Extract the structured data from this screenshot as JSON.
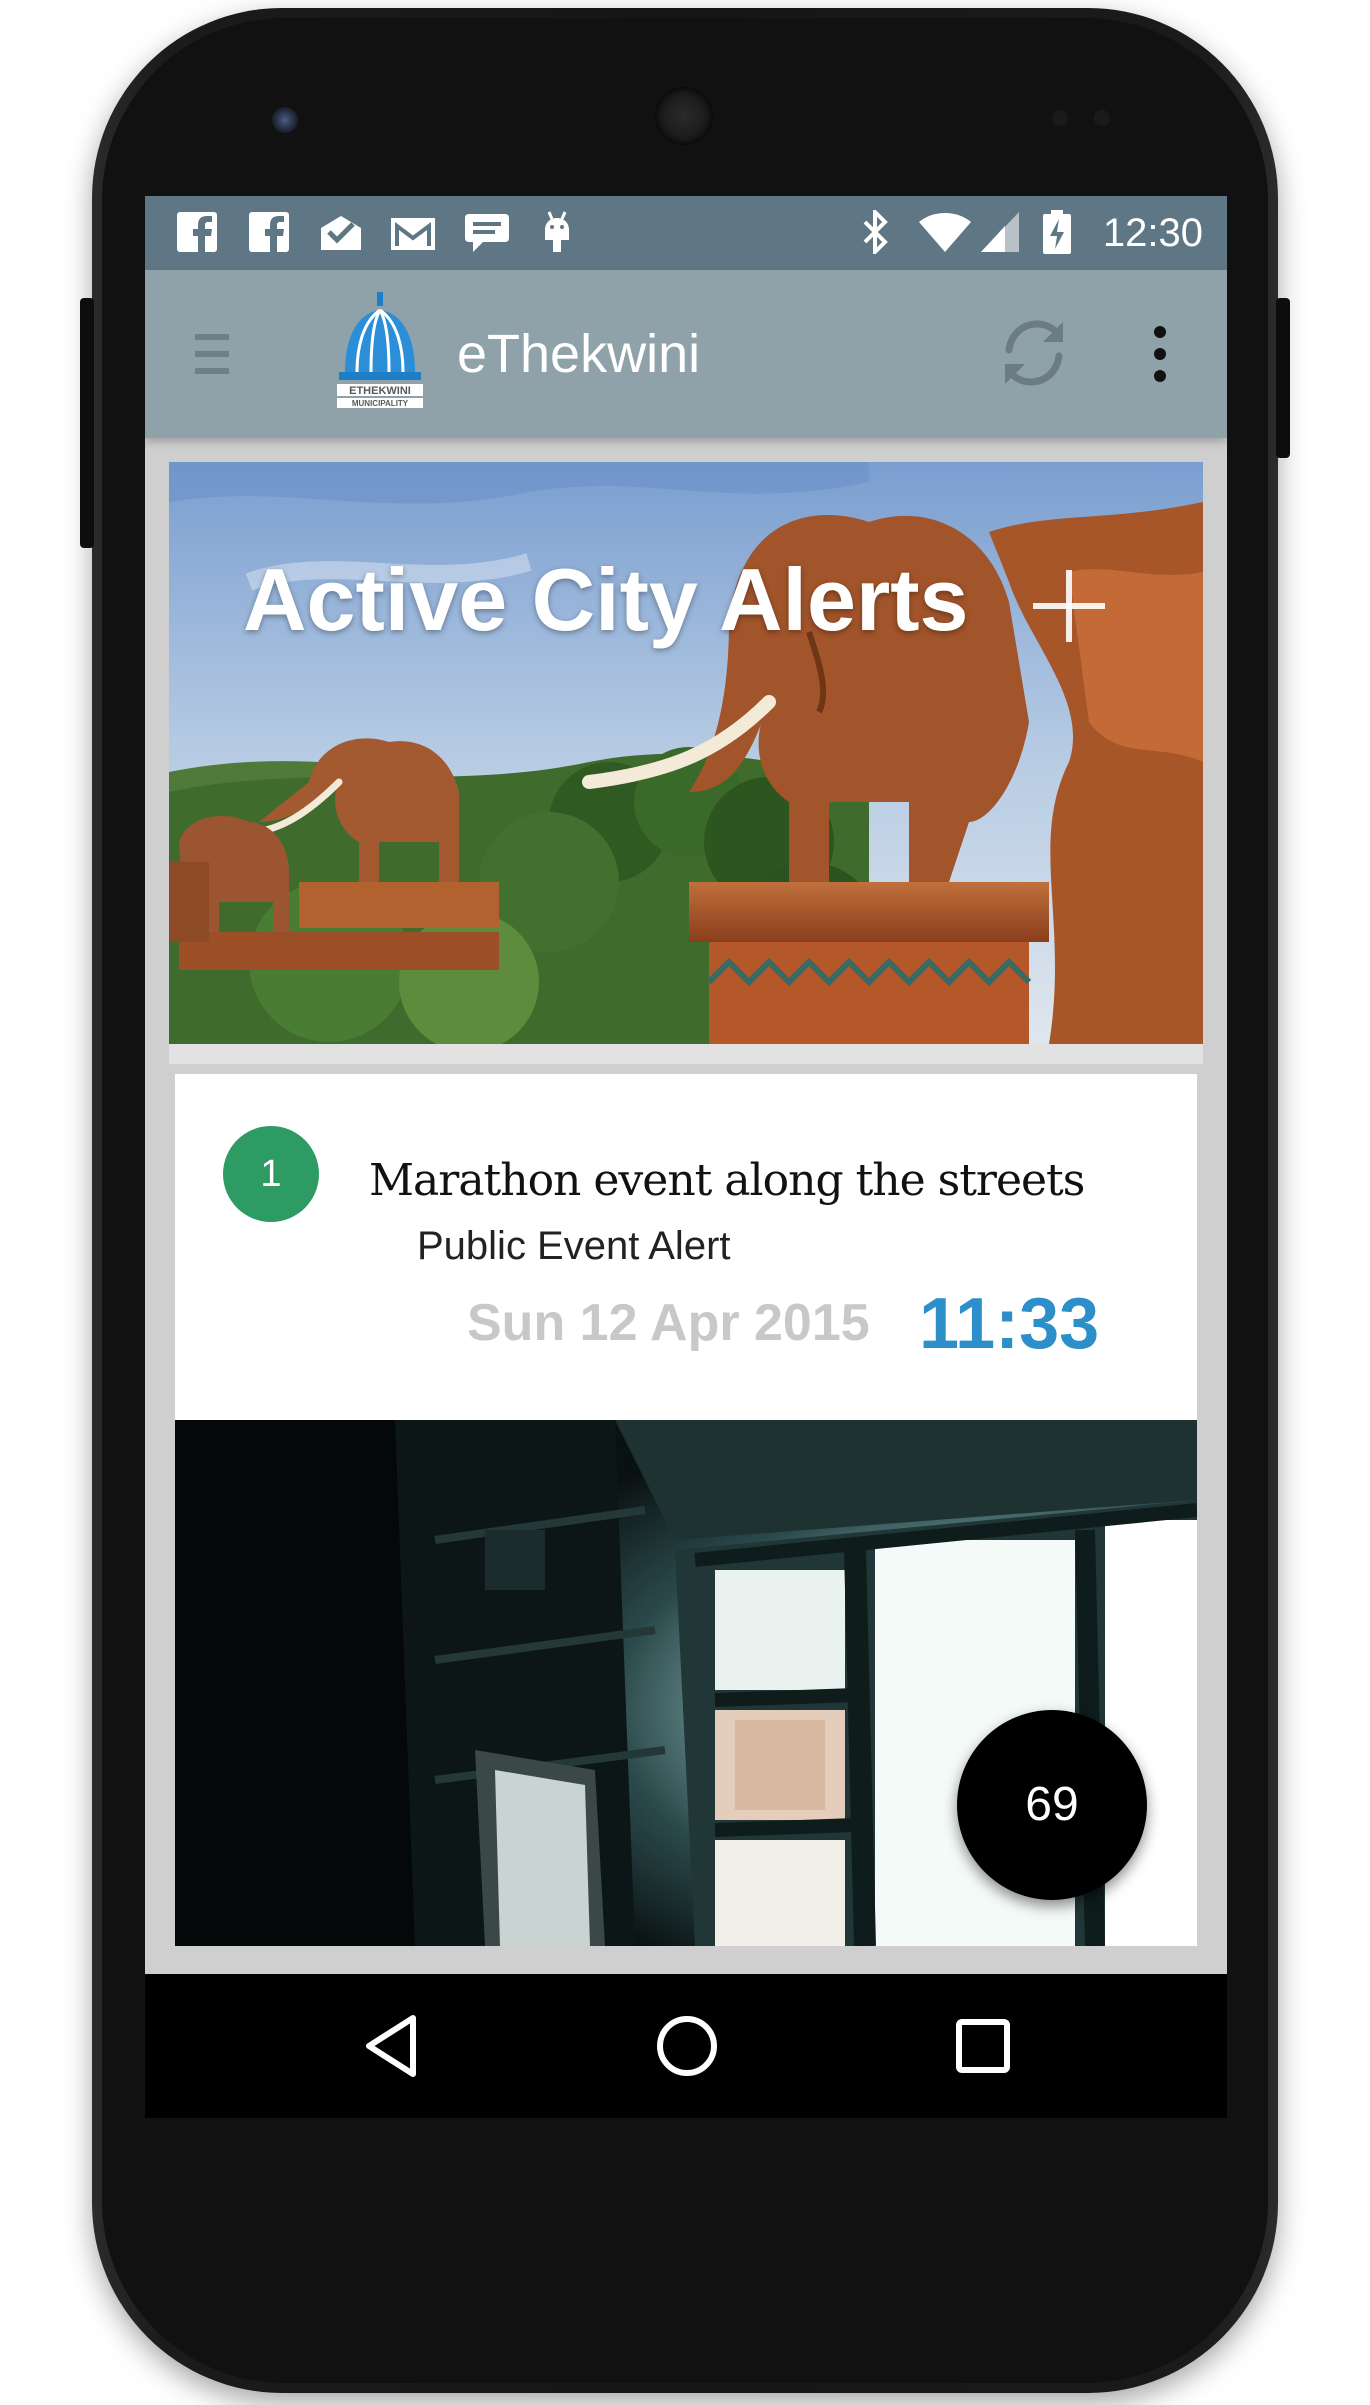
{
  "status_bar": {
    "time": "12:30",
    "left_icons": [
      "facebook-icon",
      "facebook-icon",
      "mail-check-icon",
      "gmail-icon",
      "chat-bubble-icon",
      "android-icon"
    ],
    "right_icons": [
      "bluetooth-icon",
      "wifi-icon",
      "signal-icon",
      "battery-charging-icon"
    ]
  },
  "app_bar": {
    "title": "eThekwini",
    "logo_text_line1": "ETHEKWINI",
    "logo_text_line2": "MUNICIPALITY",
    "background": "#8fa1a9"
  },
  "hero": {
    "title": "Active City Alerts"
  },
  "alert": {
    "number": "1",
    "title": "Marathon event along the streets",
    "type": "Public Event Alert",
    "date": "Sun 12 Apr 2015",
    "time": "11:33",
    "badge_color": "#2e9b64",
    "time_color": "#2d8fc9"
  },
  "fab": {
    "count": "69"
  },
  "colors": {
    "status_bar": "#5f7784",
    "app_bar": "#8fa1a9",
    "screen_bg": "#cfcfcf"
  }
}
